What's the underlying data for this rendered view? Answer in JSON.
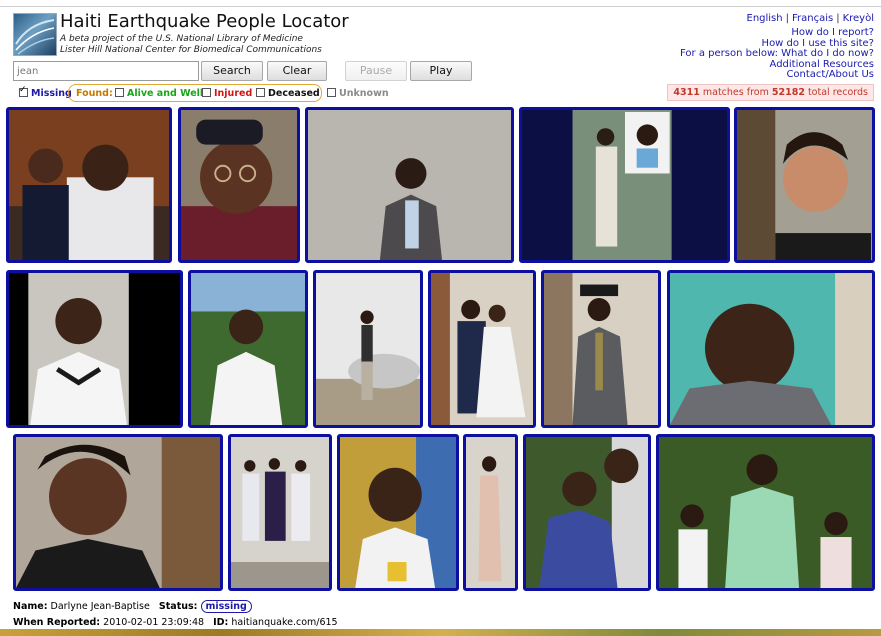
{
  "header": {
    "title": "Haiti Earthquake People Locator",
    "subtitle1": "A beta project of the U.S. National Library of Medicine",
    "subtitle2": "Lister Hill National Center for Biomedical Communications"
  },
  "languages": [
    "English",
    "Français",
    "Kreyòl"
  ],
  "help_links": [
    "How do I report?",
    "How do I use this site?",
    "For a person below: What do I do now?",
    "Additional Resources",
    "Contact/About Us"
  ],
  "search": {
    "value": "jean",
    "search_label": "Search",
    "clear_label": "Clear",
    "pause_label": "Pause",
    "play_label": "Play"
  },
  "filters": {
    "missing": "Missing",
    "found": "Found:",
    "alive": "Alive and Well",
    "injured": "Injured",
    "deceased": "Deceased",
    "unknown": "Unknown"
  },
  "colors": {
    "photo_border": "#0c0fa0",
    "alive": "#19a519",
    "injured": "#d21414",
    "missing_badge": "#1d1aa8",
    "match_text": "#c0392b"
  },
  "matches": {
    "count": "4311",
    "middle": " matches from ",
    "total": "52182",
    "suffix": " total records"
  },
  "selected": {
    "name_label": "Name:",
    "name": "Darlyne Jean-Baptise",
    "status_label": "Status:",
    "status": "missing",
    "reported_label": "When Reported:",
    "reported": "2010-02-01 23:09:48",
    "id_label": "ID:",
    "id": "haitianquake.com/615"
  },
  "photos": [
    {
      "name": "photo-1"
    },
    {
      "name": "photo-2"
    },
    {
      "name": "photo-3"
    },
    {
      "name": "photo-4"
    },
    {
      "name": "photo-5"
    },
    {
      "name": "photo-6"
    },
    {
      "name": "photo-7"
    },
    {
      "name": "photo-8"
    },
    {
      "name": "photo-9"
    },
    {
      "name": "photo-10"
    },
    {
      "name": "photo-11"
    },
    {
      "name": "photo-12"
    },
    {
      "name": "photo-13"
    },
    {
      "name": "photo-14"
    },
    {
      "name": "photo-15"
    },
    {
      "name": "photo-16"
    },
    {
      "name": "photo-17"
    }
  ]
}
